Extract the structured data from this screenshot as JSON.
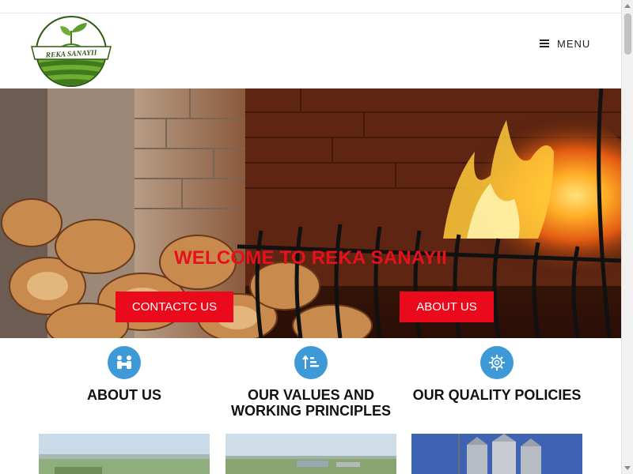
{
  "header": {
    "logo_text": "REKA SANAYII",
    "menu_label": "MENU"
  },
  "hero": {
    "title": "WELCOME TO REKA SANAYII",
    "buttons": {
      "contact": "CONTACTC US",
      "about": "ABOUT US"
    }
  },
  "features": [
    {
      "title": "ABOUT US",
      "icon": "people-icon"
    },
    {
      "title": "OUR VALUES AND WORKING PRINCIPLES",
      "icon": "sort-amount-up-icon"
    },
    {
      "title": "OUR QUALITY POLICIES",
      "icon": "gear-icon"
    }
  ],
  "colors": {
    "accent_red": "#ea0a1b",
    "icon_blue": "#3d9ad6",
    "logo_green": "#5a9e2f"
  }
}
